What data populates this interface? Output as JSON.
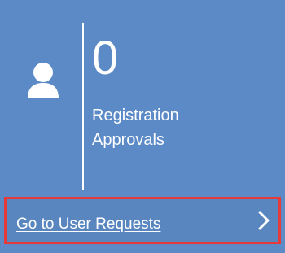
{
  "tile": {
    "icon": "user-icon",
    "count": "0",
    "label_line1": "Registration",
    "label_line2": "Approvals",
    "footer_link": "Go to User Requests",
    "footer_icon": "chevron-right-icon"
  },
  "colors": {
    "tile_background": "#5b8ac7",
    "footer_background": "#5a86c0",
    "highlight_border": "#e63a3a",
    "text": "#ffffff"
  }
}
